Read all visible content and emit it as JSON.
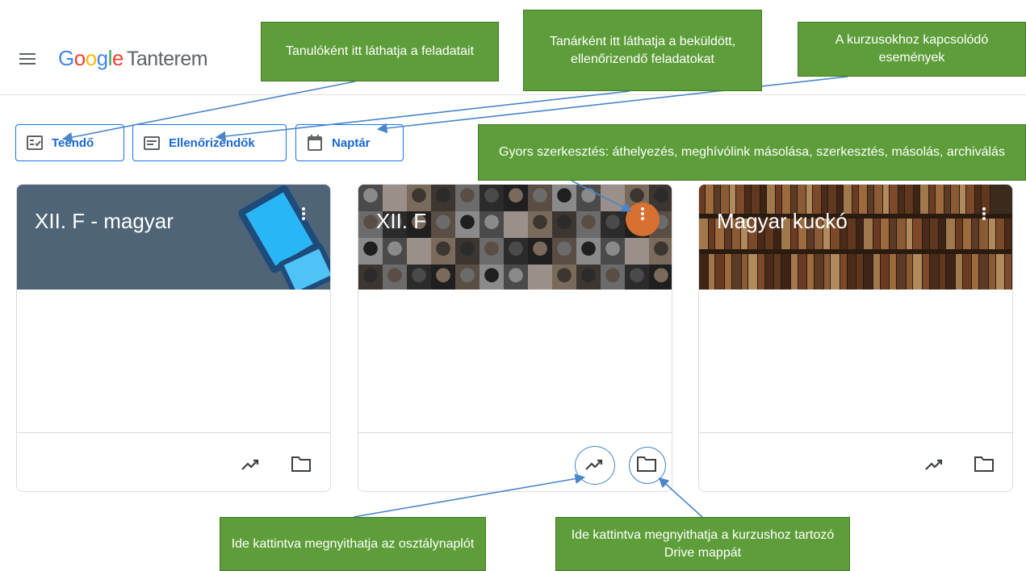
{
  "app": {
    "logo_parts": [
      "G",
      "o",
      "o",
      "g",
      "l",
      "e"
    ],
    "product": "Tanterem"
  },
  "toolbar": {
    "todo_label": "Teendő",
    "review_label": "Ellenőrizendők",
    "calendar_label": "Naptár"
  },
  "cards": [
    {
      "title": "XII. F - magyar",
      "banner": "devices-illustration"
    },
    {
      "title": "XII. F",
      "banner": "writers-portrait-mosaic"
    },
    {
      "title": "Magyar kuckó",
      "banner": "bookshelf"
    }
  ],
  "callouts": {
    "student_todo": "Tanulóként itt láthatja a feladatait",
    "teacher_review": "Tanárként itt láthatja a beküldött, ellenőrizendő feladatokat",
    "calendar_events": "A kurzusokhoz kapcsolódó események",
    "quick_edit": "Gyors szerkesztés:  áthelyezés, meghívólink másolása, szerkesztés,  másolás, archiválás",
    "gradebook": "Ide kattintva megnyithatja az osztálynaplót",
    "drive_folder": "Ide kattintva megnyithatja a kurzushoz tartozó Drive mappát"
  },
  "colors": {
    "accent": "#1a73e8",
    "callout_green": "#5e9e3a",
    "highlight_orange": "#d8702f",
    "arrow_blue": "#4a86c8"
  }
}
